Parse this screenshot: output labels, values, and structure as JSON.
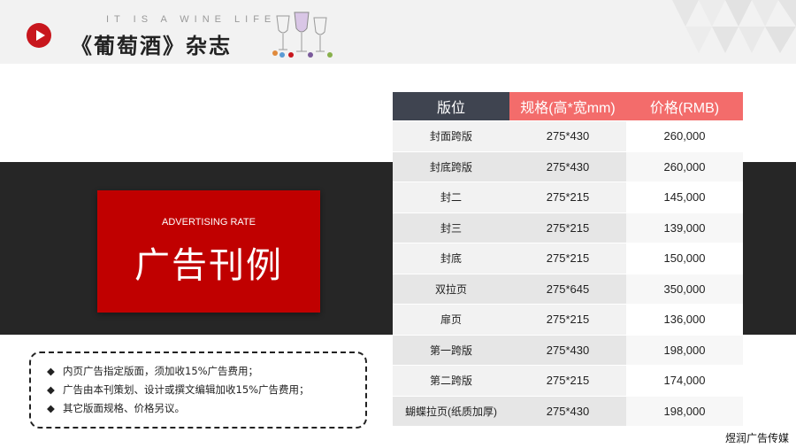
{
  "header": {
    "tagline": "IT IS A WINE LIFE",
    "title": "《葡萄酒》杂志"
  },
  "banner": {
    "subtitle": "ADVERTISING RATE",
    "title": "广告刊例"
  },
  "notes": [
    "内页广告指定版面，须加收15%广告费用；",
    "广告由本刊策划、设计或撰文编辑加收15%广告费用；",
    "其它版面规格、价格另议。"
  ],
  "table": {
    "headers": [
      "版位",
      "规格(高*宽mm)",
      "价格(RMB)"
    ],
    "rows": [
      [
        "封面跨版",
        "275*430",
        "260,000"
      ],
      [
        "封底跨版",
        "275*430",
        "260,000"
      ],
      [
        "封二",
        "275*215",
        "145,000"
      ],
      [
        "封三",
        "275*215",
        "139,000"
      ],
      [
        "封底",
        "275*215",
        "150,000"
      ],
      [
        "双拉页",
        "275*645",
        "350,000"
      ],
      [
        "扉页",
        "275*215",
        "136,000"
      ],
      [
        "第一跨版",
        "275*430",
        "198,000"
      ],
      [
        "第二跨版",
        "275*215",
        "174,000"
      ],
      [
        "蝴蝶拉页(纸质加厚)",
        "275*430",
        "198,000"
      ]
    ]
  },
  "footer": {
    "brand": "煜润广告传媒"
  },
  "colors": {
    "accent_red": "#c00000",
    "header_salmon": "#f36c6b",
    "header_slate": "#3f4450",
    "dark_band": "#262626"
  }
}
